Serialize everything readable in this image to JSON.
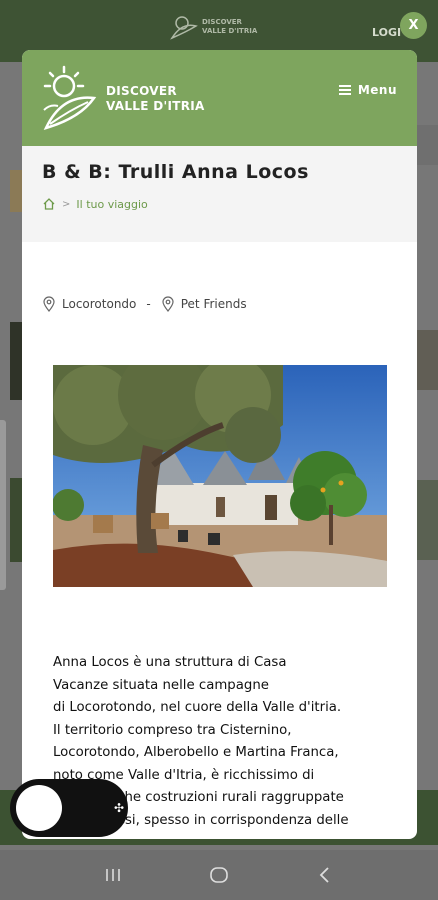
{
  "background": {
    "logo_line1": "DISCOVER",
    "logo_line2": "VALLE D'ITRIA",
    "login_label": "LOGI"
  },
  "close_label": "X",
  "modal": {
    "logo_line1": "DISCOVER",
    "logo_line2": "VALLE D'ITRIA",
    "menu_label": "Menu",
    "page_title": "B & B: Trulli Anna Locos",
    "breadcrumb": {
      "separator": ">",
      "link": "Il tuo viaggio"
    },
    "meta": {
      "location": "Locorotondo",
      "separator": "-",
      "tag": "Pet Friends"
    },
    "description_lines": [
      "Anna Locos è una struttura di Casa",
      "Vacanze situata nelle campagne",
      "di Locorotondo, nel cuore della Valle d'itria.",
      "Il territorio compreso tra Cisternino,",
      "Locorotondo, Alberobello e Martina Franca,",
      "noto come Valle d'Itria, è ricchissimo di",
      "trulli, antiche costruzioni rurali raggruppate",
      "in complessi, spesso in corrispondenza delle"
    ]
  },
  "colors": {
    "brand_green": "#7ea55e",
    "dark_green": "#3e5334",
    "link_green": "#6d9a4a"
  },
  "icons": {
    "home": "home-icon",
    "pin": "map-pin-icon",
    "menu": "hamburger-icon",
    "close": "close-icon"
  }
}
